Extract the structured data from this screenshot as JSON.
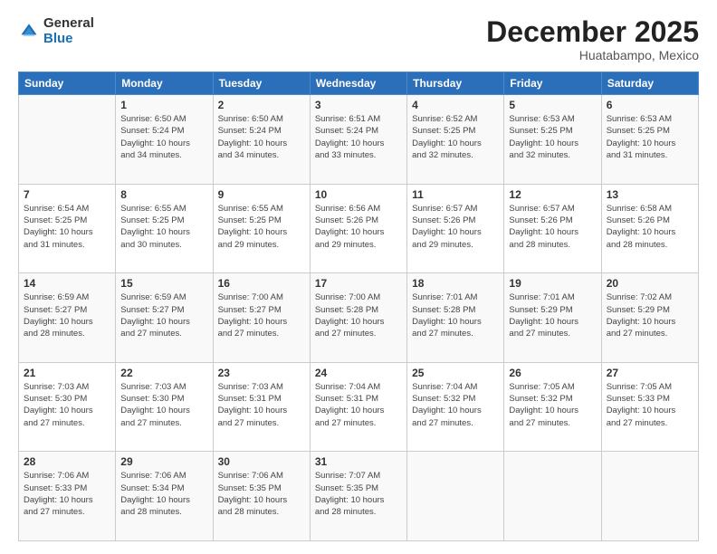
{
  "header": {
    "logo_line1": "General",
    "logo_line2": "Blue",
    "month": "December 2025",
    "location": "Huatabampo, Mexico"
  },
  "days_of_week": [
    "Sunday",
    "Monday",
    "Tuesday",
    "Wednesday",
    "Thursday",
    "Friday",
    "Saturday"
  ],
  "weeks": [
    [
      {
        "num": "",
        "info": ""
      },
      {
        "num": "1",
        "info": "Sunrise: 6:50 AM\nSunset: 5:24 PM\nDaylight: 10 hours\nand 34 minutes."
      },
      {
        "num": "2",
        "info": "Sunrise: 6:50 AM\nSunset: 5:24 PM\nDaylight: 10 hours\nand 34 minutes."
      },
      {
        "num": "3",
        "info": "Sunrise: 6:51 AM\nSunset: 5:24 PM\nDaylight: 10 hours\nand 33 minutes."
      },
      {
        "num": "4",
        "info": "Sunrise: 6:52 AM\nSunset: 5:25 PM\nDaylight: 10 hours\nand 32 minutes."
      },
      {
        "num": "5",
        "info": "Sunrise: 6:53 AM\nSunset: 5:25 PM\nDaylight: 10 hours\nand 32 minutes."
      },
      {
        "num": "6",
        "info": "Sunrise: 6:53 AM\nSunset: 5:25 PM\nDaylight: 10 hours\nand 31 minutes."
      }
    ],
    [
      {
        "num": "7",
        "info": "Sunrise: 6:54 AM\nSunset: 5:25 PM\nDaylight: 10 hours\nand 31 minutes."
      },
      {
        "num": "8",
        "info": "Sunrise: 6:55 AM\nSunset: 5:25 PM\nDaylight: 10 hours\nand 30 minutes."
      },
      {
        "num": "9",
        "info": "Sunrise: 6:55 AM\nSunset: 5:25 PM\nDaylight: 10 hours\nand 29 minutes."
      },
      {
        "num": "10",
        "info": "Sunrise: 6:56 AM\nSunset: 5:26 PM\nDaylight: 10 hours\nand 29 minutes."
      },
      {
        "num": "11",
        "info": "Sunrise: 6:57 AM\nSunset: 5:26 PM\nDaylight: 10 hours\nand 29 minutes."
      },
      {
        "num": "12",
        "info": "Sunrise: 6:57 AM\nSunset: 5:26 PM\nDaylight: 10 hours\nand 28 minutes."
      },
      {
        "num": "13",
        "info": "Sunrise: 6:58 AM\nSunset: 5:26 PM\nDaylight: 10 hours\nand 28 minutes."
      }
    ],
    [
      {
        "num": "14",
        "info": "Sunrise: 6:59 AM\nSunset: 5:27 PM\nDaylight: 10 hours\nand 28 minutes."
      },
      {
        "num": "15",
        "info": "Sunrise: 6:59 AM\nSunset: 5:27 PM\nDaylight: 10 hours\nand 27 minutes."
      },
      {
        "num": "16",
        "info": "Sunrise: 7:00 AM\nSunset: 5:27 PM\nDaylight: 10 hours\nand 27 minutes."
      },
      {
        "num": "17",
        "info": "Sunrise: 7:00 AM\nSunset: 5:28 PM\nDaylight: 10 hours\nand 27 minutes."
      },
      {
        "num": "18",
        "info": "Sunrise: 7:01 AM\nSunset: 5:28 PM\nDaylight: 10 hours\nand 27 minutes."
      },
      {
        "num": "19",
        "info": "Sunrise: 7:01 AM\nSunset: 5:29 PM\nDaylight: 10 hours\nand 27 minutes."
      },
      {
        "num": "20",
        "info": "Sunrise: 7:02 AM\nSunset: 5:29 PM\nDaylight: 10 hours\nand 27 minutes."
      }
    ],
    [
      {
        "num": "21",
        "info": "Sunrise: 7:03 AM\nSunset: 5:30 PM\nDaylight: 10 hours\nand 27 minutes."
      },
      {
        "num": "22",
        "info": "Sunrise: 7:03 AM\nSunset: 5:30 PM\nDaylight: 10 hours\nand 27 minutes."
      },
      {
        "num": "23",
        "info": "Sunrise: 7:03 AM\nSunset: 5:31 PM\nDaylight: 10 hours\nand 27 minutes."
      },
      {
        "num": "24",
        "info": "Sunrise: 7:04 AM\nSunset: 5:31 PM\nDaylight: 10 hours\nand 27 minutes."
      },
      {
        "num": "25",
        "info": "Sunrise: 7:04 AM\nSunset: 5:32 PM\nDaylight: 10 hours\nand 27 minutes."
      },
      {
        "num": "26",
        "info": "Sunrise: 7:05 AM\nSunset: 5:32 PM\nDaylight: 10 hours\nand 27 minutes."
      },
      {
        "num": "27",
        "info": "Sunrise: 7:05 AM\nSunset: 5:33 PM\nDaylight: 10 hours\nand 27 minutes."
      }
    ],
    [
      {
        "num": "28",
        "info": "Sunrise: 7:06 AM\nSunset: 5:33 PM\nDaylight: 10 hours\nand 27 minutes."
      },
      {
        "num": "29",
        "info": "Sunrise: 7:06 AM\nSunset: 5:34 PM\nDaylight: 10 hours\nand 28 minutes."
      },
      {
        "num": "30",
        "info": "Sunrise: 7:06 AM\nSunset: 5:35 PM\nDaylight: 10 hours\nand 28 minutes."
      },
      {
        "num": "31",
        "info": "Sunrise: 7:07 AM\nSunset: 5:35 PM\nDaylight: 10 hours\nand 28 minutes."
      },
      {
        "num": "",
        "info": ""
      },
      {
        "num": "",
        "info": ""
      },
      {
        "num": "",
        "info": ""
      }
    ]
  ]
}
